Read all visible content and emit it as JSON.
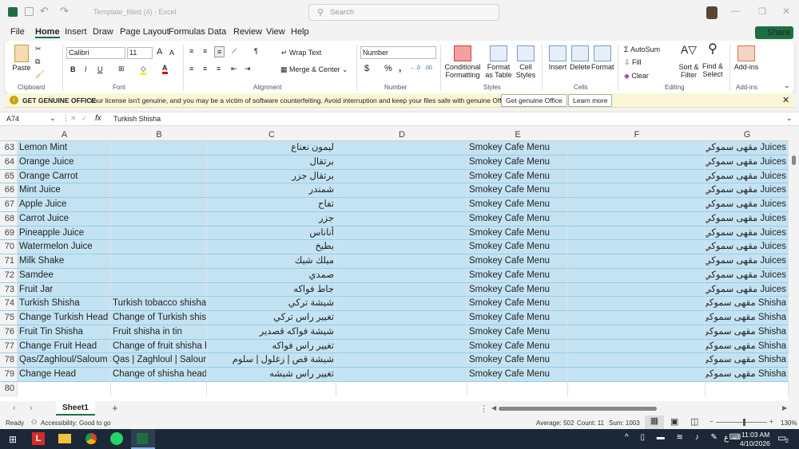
{
  "title": {
    "filename": "Template_filled (4)",
    "app": "Excel",
    "search_placeholder": "Search",
    "share": "Share"
  },
  "menu": [
    "File",
    "Home",
    "Insert",
    "Draw",
    "Page Layout",
    "Formulas",
    "Data",
    "Review",
    "View",
    "Help"
  ],
  "ribbon": {
    "clipboard": {
      "paste": "Paste",
      "label": "Clipboard"
    },
    "font": {
      "name": "Calibri",
      "size": "11",
      "label": "Font",
      "bold": "B",
      "italic": "I",
      "underline": "U"
    },
    "alignment": {
      "wrap": "Wrap Text",
      "merge": "Merge & Center",
      "label": "Alignment"
    },
    "number": {
      "format": "Number",
      "label": "Number",
      "currency": "$",
      "percent": "%"
    },
    "styles": {
      "conditional": "Conditional Formatting",
      "format_table": "Format as Table",
      "cell_styles": "Cell Styles",
      "label": "Styles"
    },
    "cells": {
      "insert": "Insert",
      "delete": "Delete",
      "format": "Format",
      "label": "Cells"
    },
    "editing": {
      "autosum": "AutoSum",
      "fill": "Fill",
      "clear": "Clear",
      "sort": "Sort & Filter",
      "find": "Find & Select",
      "label": "Editing"
    },
    "addins": {
      "button": "Add-ins",
      "label": "Add-ins"
    }
  },
  "notice": {
    "title": "GET GENUINE OFFICE",
    "text": "Your license isn't genuine, and you may be a victim of software counterfeiting. Avoid interruption and keep your files safe with genuine Office today.",
    "btn1": "Get genuine Office",
    "btn2": "Learn more"
  },
  "formula_bar": {
    "name_box": "A74",
    "fx": "fx",
    "value": "Turkish Shisha"
  },
  "columns": [
    "A",
    "B",
    "C",
    "D",
    "E",
    "F",
    "G"
  ],
  "rows": [
    {
      "n": "63",
      "a": "Lemon Mint",
      "b": "",
      "c": "ليمون نعناع",
      "e": "Smokey Cafe Menu",
      "g": "Juices مقهى سموكي"
    },
    {
      "n": "64",
      "a": "Orange Juice",
      "b": "",
      "c": "برتقال",
      "e": "Smokey Cafe Menu",
      "g": "Juices مقهى سموكي"
    },
    {
      "n": "65",
      "a": "Orange Carrot",
      "b": "",
      "c": "برتقال جزر",
      "e": "Smokey Cafe Menu",
      "g": "Juices مقهى سموكي"
    },
    {
      "n": "66",
      "a": "Mint Juice",
      "b": "",
      "c": "شمندر",
      "e": "Smokey Cafe Menu",
      "g": "Juices مقهى سموكي"
    },
    {
      "n": "67",
      "a": "Apple Juice",
      "b": "",
      "c": "تفاح",
      "e": "Smokey Cafe Menu",
      "g": "Juices مقهى سموكي"
    },
    {
      "n": "68",
      "a": "Carrot Juice",
      "b": "",
      "c": "جزر",
      "e": "Smokey Cafe Menu",
      "g": "Juices مقهى سموكي"
    },
    {
      "n": "69",
      "a": "Pineapple Juice",
      "b": "",
      "c": "أناناس",
      "e": "Smokey Cafe Menu",
      "g": "Juices مقهى سموكي"
    },
    {
      "n": "70",
      "a": "Watermelon Juice",
      "b": "",
      "c": "بطيخ",
      "e": "Smokey Cafe Menu",
      "g": "Juices مقهى سموكي"
    },
    {
      "n": "71",
      "a": "Milk Shake",
      "b": "",
      "c": "ميلك شيك",
      "e": "Smokey Cafe Menu",
      "g": "Juices مقهى سموكي"
    },
    {
      "n": "72",
      "a": "Samdee",
      "b": "",
      "c": "صمدي",
      "e": "Smokey Cafe Menu",
      "g": "Juices مقهى سموكي"
    },
    {
      "n": "73",
      "a": "Fruit Jar",
      "b": "",
      "c": "جاط فواكه",
      "e": "Smokey Cafe Menu",
      "g": "Juices مقهى سموكي"
    },
    {
      "n": "74",
      "a": "Turkish Shisha",
      "b": "Turkish tobacco shisha",
      "c": "شيشة تركي",
      "e": "Smokey Cafe Menu",
      "g": "Shisha مقهى سموكي"
    },
    {
      "n": "75",
      "a": "Change Turkish Head",
      "b": "Change of Turkish shisha head",
      "c": "تغيير راس تركي",
      "e": "Smokey Cafe Menu",
      "g": "Shisha مقهى سموكي"
    },
    {
      "n": "76",
      "a": "Fruit Tin Shisha",
      "b": "Fruit shisha in tin",
      "c": "شيشة فواكه قصدير",
      "e": "Smokey Cafe Menu",
      "g": "Shisha مقهى سموكي"
    },
    {
      "n": "77",
      "a": "Change Fruit Head",
      "b": "Change of fruit shisha head",
      "c": "تغيير راس فواكه",
      "e": "Smokey Cafe Menu",
      "g": "Shisha مقهى سموكي"
    },
    {
      "n": "78",
      "a": "Qas/Zaghloul/Saloum Shisha",
      "b": "Qas | Zaghloul | Saloum",
      "c": "شيشة قص | زغلول | سلوم",
      "e": "Smokey Cafe Menu",
      "g": "Shisha مقهى سموكي"
    },
    {
      "n": "79",
      "a": "Change Head",
      "b": "Change of shisha head",
      "c": "تغيير راس شيشه",
      "e": "Smokey Cafe Menu",
      "g": "Shisha مقهى سموكي"
    },
    {
      "n": "80",
      "a": "",
      "b": "",
      "c": "",
      "e": "",
      "g": ""
    }
  ],
  "sheet": {
    "tab": "Sheet1",
    "add": "+"
  },
  "status": {
    "ready": "Ready",
    "accessibility": "Accessibility: Good to go",
    "average": "Average: 502",
    "count": "Count: 11",
    "sum": "Sum: 1003",
    "zoom": "130%"
  },
  "taskbar": {
    "time": "11:03 AM",
    "date": "4/10/2026",
    "lang": "ع",
    "notif": "2"
  }
}
